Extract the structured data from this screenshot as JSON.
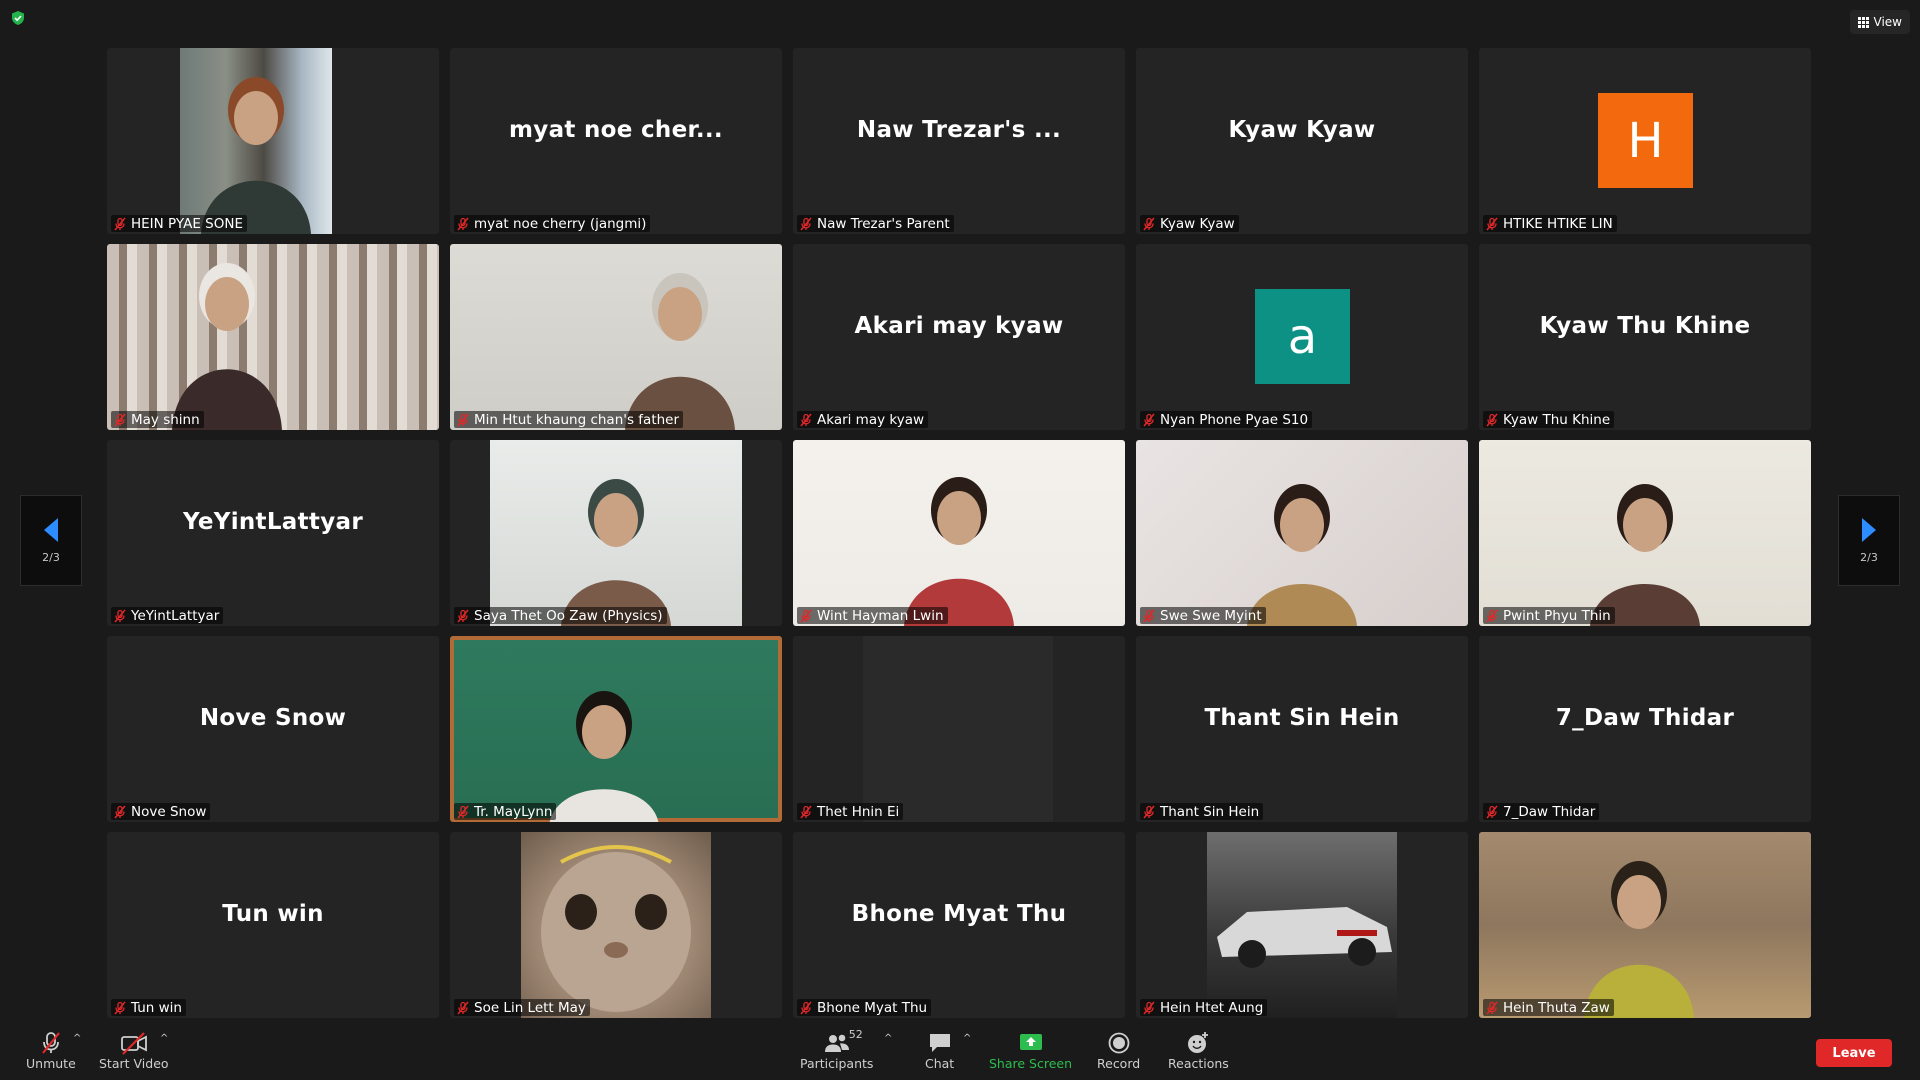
{
  "view_button": {
    "label": "View"
  },
  "pagination": {
    "left_label": "2/3",
    "right_label": "2/3"
  },
  "tiles": [
    {
      "type": "video",
      "name": "HEIN PYAE SONE",
      "video_style": "room"
    },
    {
      "type": "text",
      "display": "myat noe cher...",
      "name": "myat noe cherry (jangmi)"
    },
    {
      "type": "text",
      "display": "Naw Trezar's ...",
      "name": "Naw Trezar's Parent"
    },
    {
      "type": "text",
      "display": "Kyaw Kyaw",
      "name": "Kyaw Kyaw"
    },
    {
      "type": "avatar",
      "initial": "H",
      "color": "#f26a0d",
      "name": "HTIKE HTIKE LIN"
    },
    {
      "type": "video",
      "name": "May shinn",
      "video_style": "curtain"
    },
    {
      "type": "video",
      "name": "Min Htut khaung chan's father",
      "video_style": "man"
    },
    {
      "type": "text",
      "display": "Akari may kyaw",
      "name": "Akari may kyaw"
    },
    {
      "type": "avatar",
      "initial": "a",
      "color": "#0e9185",
      "name": "Nyan Phone Pyae S10"
    },
    {
      "type": "text",
      "display": "Kyaw Thu Khine",
      "name": "Kyaw Thu Khine"
    },
    {
      "type": "text",
      "display": "YeYintLattyar",
      "name": "YeYintLattyar"
    },
    {
      "type": "video",
      "name": "Saya Thet Oo Zaw (Physics)",
      "video_style": "teacher"
    },
    {
      "type": "video",
      "name": "Wint Hayman Lwin",
      "video_style": "red"
    },
    {
      "type": "video",
      "name": "Swe Swe Myint",
      "video_style": "beige"
    },
    {
      "type": "video",
      "name": "Pwint Phyu Thin",
      "video_style": "light"
    },
    {
      "type": "text",
      "display": "Nove Snow",
      "name": "Nove Snow"
    },
    {
      "type": "video",
      "name": "Tr. MayLynn",
      "video_style": "chalk"
    },
    {
      "type": "video",
      "name": "Thet Hnin Ei",
      "video_style": "dark"
    },
    {
      "type": "text",
      "display": "Thant Sin Hein",
      "name": "Thant Sin Hein"
    },
    {
      "type": "text",
      "display": "7_Daw Thidar",
      "name": "7_Daw Thidar"
    },
    {
      "type": "text",
      "display": "Tun win",
      "name": "Tun win"
    },
    {
      "type": "video",
      "name": "Soe Lin Lett May",
      "video_style": "cat"
    },
    {
      "type": "text",
      "display": "Bhone Myat Thu",
      "name": "Bhone Myat Thu"
    },
    {
      "type": "video",
      "name": "Hein Htet Aung",
      "video_style": "car"
    },
    {
      "type": "video",
      "name": "Hein Thuta Zaw",
      "video_style": "yellow"
    }
  ],
  "toolbar": {
    "unmute": "Unmute",
    "start_video": "Start Video",
    "participants": "Participants",
    "participants_count": "52",
    "chat": "Chat",
    "share_screen": "Share Screen",
    "record": "Record",
    "reactions": "Reactions",
    "leave": "Leave"
  },
  "colors": {
    "background": "#1a1a1a",
    "tile": "#242424",
    "accent_blue": "#2d8cff",
    "muted_red": "#e02828",
    "share_green": "#2dbd4e"
  }
}
